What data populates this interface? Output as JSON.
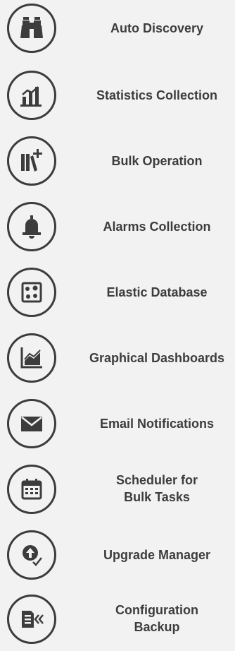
{
  "features": [
    {
      "id": "auto-discovery",
      "label_lines": [
        "Auto Discovery"
      ],
      "icon": "binoculars-icon"
    },
    {
      "id": "statistics-collection",
      "label_lines": [
        "Statistics Collection"
      ],
      "icon": "bar-chart-icon"
    },
    {
      "id": "bulk-operation",
      "label_lines": [
        "Bulk Operation"
      ],
      "icon": "books-plus-icon"
    },
    {
      "id": "alarms-collection",
      "label_lines": [
        "Alarms Collection"
      ],
      "icon": "bell-icon"
    },
    {
      "id": "elastic-database",
      "label_lines": [
        "Elastic Database"
      ],
      "icon": "database-dots-icon"
    },
    {
      "id": "graphical-dashboards",
      "label_lines": [
        "Graphical Dashboards"
      ],
      "icon": "area-chart-icon"
    },
    {
      "id": "email-notifications",
      "label_lines": [
        "Email Notifications"
      ],
      "icon": "envelope-icon"
    },
    {
      "id": "scheduler-for-bulk-tasks",
      "label_lines": [
        "Scheduler for",
        "Bulk Tasks"
      ],
      "icon": "calendar-icon"
    },
    {
      "id": "upgrade-manager",
      "label_lines": [
        "Upgrade Manager"
      ],
      "icon": "upgrade-arrow-check-icon"
    },
    {
      "id": "configuration-backup",
      "label_lines": [
        "Configuration",
        "Backup"
      ],
      "icon": "backup-file-icon"
    }
  ],
  "colors": {
    "background": "#f2f2f2",
    "icon": "#3c3c3c",
    "text": "#3d3d3d"
  }
}
